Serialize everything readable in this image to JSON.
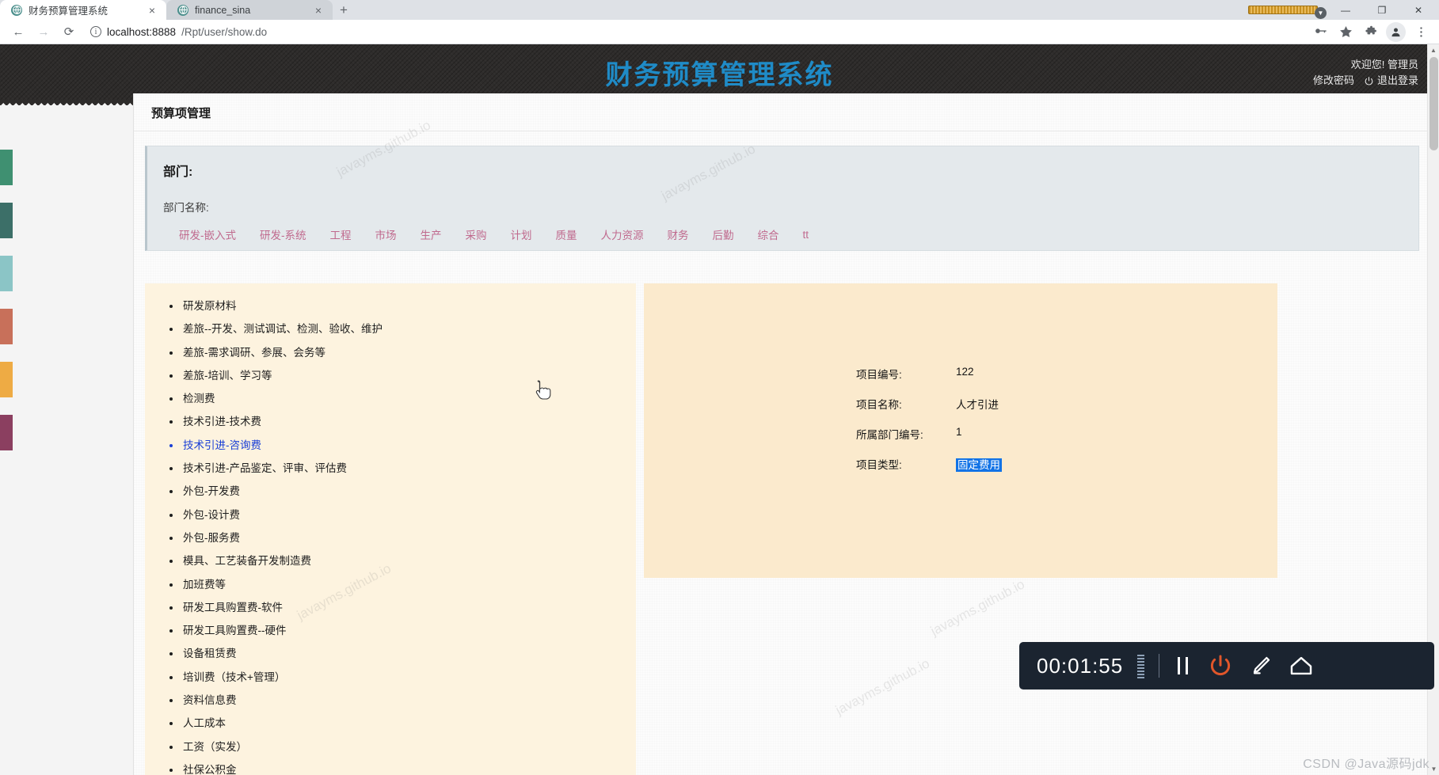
{
  "browser": {
    "tabs": [
      {
        "title": "财务预算管理系统",
        "active": true,
        "favicon": "globe-icon",
        "close": "×"
      },
      {
        "title": "finance_sina",
        "active": false,
        "favicon": "globe-icon",
        "close": "×"
      }
    ],
    "new_tab_label": "+",
    "window_controls": {
      "minimize": "—",
      "maximize": "❐",
      "close": "✕"
    },
    "nav": {
      "back": "←",
      "forward": "→",
      "reload": "⟳"
    },
    "address": {
      "info_icon": "ⓘ",
      "host": "localhost:8888",
      "path": "/Rpt/user/show.do",
      "full": "localhost:8888/Rpt/user/show.do"
    },
    "toolbar_icons": [
      "key-icon",
      "bookmark-star-icon",
      "extensions-puzzle-icon",
      "profile-avatar-icon",
      "three-dot-menu-icon"
    ]
  },
  "app": {
    "title": "财务预算管理系统",
    "title_color": "#1f8bc7",
    "user": {
      "welcome": "欢迎您!",
      "name": "管理员",
      "change_password": "修改密码",
      "logout": "退出登录"
    }
  },
  "page": {
    "heading": "预算项管理"
  },
  "department_panel": {
    "title": "部门:",
    "name_label": "部门名称:",
    "link_color": "#c06a8e",
    "links": [
      "研发-嵌入式",
      "研发-系统",
      "工程",
      "市场",
      "生产",
      "采购",
      "计划",
      "质量",
      "人力资源",
      "财务",
      "后勤",
      "综合",
      "tt"
    ]
  },
  "budget_items": {
    "selected_index": 6,
    "items": [
      "研发原材料",
      "差旅--开发、测试调试、检测、验收、维护",
      "差旅-需求调研、参展、会务等",
      "差旅-培训、学习等",
      "检测费",
      "技术引进-技术费",
      "技术引进-咨询费",
      "技术引进-产品鉴定、评审、评估费",
      "外包-开发费",
      "外包-设计费",
      "外包-服务费",
      "模具、工艺装备开发制造费",
      "加班费等",
      "研发工具购置费-软件",
      "研发工具购置费--硬件",
      "设备租赁费",
      "培训费（技术+管理）",
      "资料信息费",
      "人工成本",
      "工资（实发）",
      "社保公积金"
    ]
  },
  "detail": {
    "fields": [
      {
        "label": "项目编号:",
        "value": "122",
        "highlighted": false
      },
      {
        "label": "项目名称:",
        "value": "人才引进",
        "highlighted": false
      },
      {
        "label": "所属部门编号:",
        "value": "1",
        "highlighted": false
      },
      {
        "label": "项目类型:",
        "value": "固定费用",
        "highlighted": true
      }
    ]
  },
  "swatches": [
    "#3f9071",
    "#3c6f68",
    "#8bc5c6",
    "#c8705a",
    "#eeab44",
    "#8b3f60"
  ],
  "recorder": {
    "time": "00:01:55",
    "buttons": [
      "pause-icon",
      "stop-power-icon",
      "pen-edit-icon",
      "home-icon"
    ],
    "stop_color": "#e0562a"
  },
  "watermarks": {
    "site": "javayms.github.io",
    "csdn": "CSDN @Java源码jdk"
  }
}
